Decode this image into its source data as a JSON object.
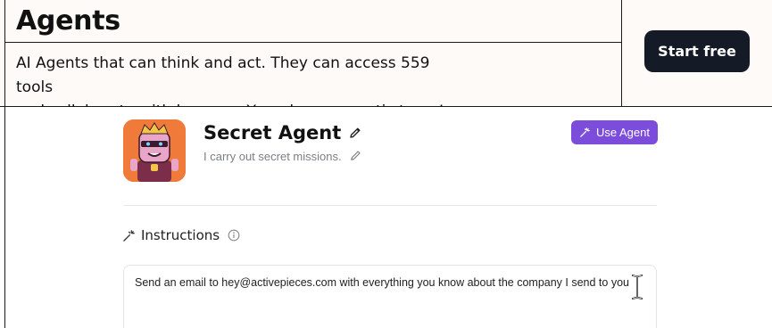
{
  "header": {
    "title": "Agents",
    "tagline_line1": "AI Agents that can think and act. They can access 559 tools",
    "tagline_line2": "and collaborate with humans. Your dream agentic team!",
    "cta_label": "Start free"
  },
  "agent": {
    "name": "Secret Agent",
    "description": "I carry out secret missions.",
    "use_label": "Use Agent",
    "avatar_icon": "robot-agent-avatar"
  },
  "instructions": {
    "label": "Instructions",
    "text": "Send an email to hey@activepieces.com with everything you know about the company I send to you"
  },
  "colors": {
    "cta_bg": "#141a26",
    "use_agent_bg": "#7c4ddb",
    "avatar_bg": "#f07a3a"
  }
}
